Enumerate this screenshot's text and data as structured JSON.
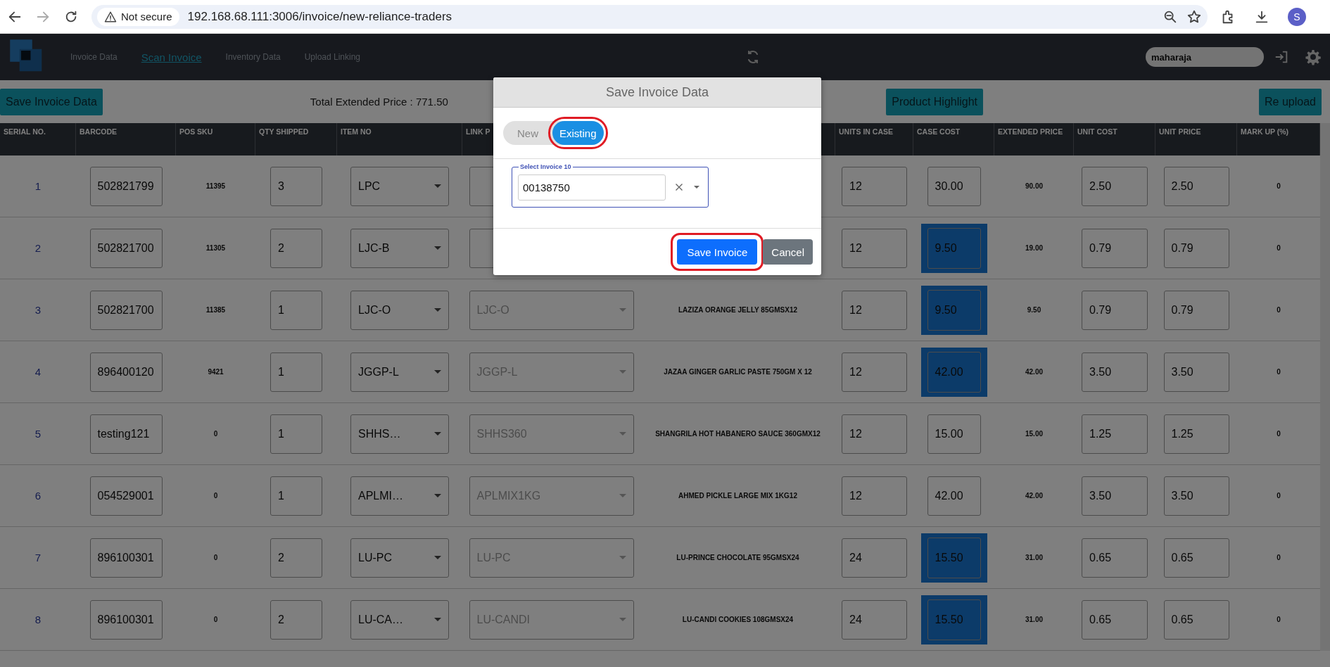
{
  "browser": {
    "security": "Not secure",
    "url": "192.168.68.111:3006/invoice/new-reliance-traders",
    "profile_initial": "S"
  },
  "nav": {
    "tabs": [
      {
        "label": "Invoice Data",
        "selected": false
      },
      {
        "label": "Scan Invoice",
        "selected": true
      },
      {
        "label": "Inventory Data",
        "selected": false
      },
      {
        "label": "Upload Linking",
        "selected": false
      }
    ],
    "user_field": "maharaja"
  },
  "toolbar": {
    "save_button": "Save Invoice Data",
    "total": "Total Extended Price : 771.50",
    "highlight_button": "Product Highlight",
    "reupload_button": "Re upload"
  },
  "table": {
    "columns": [
      "SERIAL NO.",
      "BARCODE",
      "POS SKU",
      "QTY SHIPPED",
      "ITEM NO",
      "LINK P",
      "UNITS IN CASE",
      "CASE COST",
      "EXTENDED PRICE",
      "UNIT COST",
      "UNIT PRICE",
      "MARK UP (%)"
    ],
    "rows": [
      {
        "serial": "1",
        "barcode": "502821799",
        "pos_sku": "11395",
        "qty": "3",
        "item_no": "LPC",
        "units": "12",
        "case_cost": "30.00",
        "case_cost_highlighted": false,
        "extended": "90.00",
        "unit_cost": "2.50",
        "unit_price": "2.50",
        "markup": "0"
      },
      {
        "serial": "2",
        "barcode": "502821700",
        "pos_sku": "11305",
        "qty": "2",
        "item_no": "LJC-B",
        "units": "12",
        "case_cost": "9.50",
        "case_cost_highlighted": true,
        "extended": "19.00",
        "unit_cost": "0.79",
        "unit_price": "0.79",
        "markup": "0"
      },
      {
        "serial": "3",
        "barcode": "502821700",
        "pos_sku": "11385",
        "qty": "1",
        "item_no": "LJC-O",
        "link": "LJC-O",
        "description": "LAZIZA ORANGE JELLY 85GMSX12",
        "units": "12",
        "case_cost": "9.50",
        "case_cost_highlighted": true,
        "extended": "9.50",
        "unit_cost": "0.79",
        "unit_price": "0.79",
        "markup": "0"
      },
      {
        "serial": "4",
        "barcode": "896400120",
        "pos_sku": "9421",
        "qty": "1",
        "item_no": "JGGP-L",
        "link": "JGGP-L",
        "description": "JAZAA GINGER GARLIC PASTE 750GM X 12",
        "units": "12",
        "case_cost": "42.00",
        "case_cost_highlighted": true,
        "extended": "42.00",
        "unit_cost": "3.50",
        "unit_price": "3.50",
        "markup": "0"
      },
      {
        "serial": "5",
        "barcode": "testing121",
        "pos_sku": "0",
        "qty": "1",
        "item_no": "SHHS…",
        "link": "SHHS360",
        "description": "SHANGRILA HOT HABANERO SAUCE 360GMX12",
        "units": "12",
        "case_cost": "15.00",
        "case_cost_highlighted": false,
        "extended": "15.00",
        "unit_cost": "1.25",
        "unit_price": "1.25",
        "markup": "0"
      },
      {
        "serial": "6",
        "barcode": "054529001",
        "pos_sku": "0",
        "qty": "1",
        "item_no": "APLMI…",
        "link": "APLMIX1KG",
        "description": "AHMED PICKLE LARGE MIX 1KG12",
        "units": "12",
        "case_cost": "42.00",
        "case_cost_highlighted": false,
        "extended": "42.00",
        "unit_cost": "3.50",
        "unit_price": "3.50",
        "markup": "0"
      },
      {
        "serial": "7",
        "barcode": "896100301",
        "pos_sku": "0",
        "qty": "2",
        "item_no": "LU-PC",
        "link": "LU-PC",
        "description": "LU-PRINCE CHOCOLATE 95GMSX24",
        "units": "24",
        "case_cost": "15.50",
        "case_cost_highlighted": true,
        "extended": "31.00",
        "unit_cost": "0.65",
        "unit_price": "0.65",
        "markup": "0"
      },
      {
        "serial": "8",
        "barcode": "896100301",
        "pos_sku": "0",
        "qty": "2",
        "item_no": "LU-CA…",
        "link": "LU-CANDI",
        "description": "LU-CANDI COOKIES 108GMSX24",
        "units": "24",
        "case_cost": "15.50",
        "case_cost_highlighted": true,
        "extended": "31.00",
        "unit_cost": "0.65",
        "unit_price": "0.65",
        "markup": "0"
      }
    ]
  },
  "modal": {
    "title": "Save Invoice Data",
    "modes": [
      {
        "label": "New",
        "selected": false,
        "annotated": false
      },
      {
        "label": "Existing",
        "selected": true,
        "annotated": true
      }
    ],
    "field": {
      "label": "Select Invoice 10",
      "value": "00138750"
    },
    "buttons": [
      {
        "label": "Save Invoice",
        "kind": "primary",
        "annotated": true
      },
      {
        "label": "Cancel",
        "kind": "secondary",
        "annotated": false
      }
    ]
  }
}
